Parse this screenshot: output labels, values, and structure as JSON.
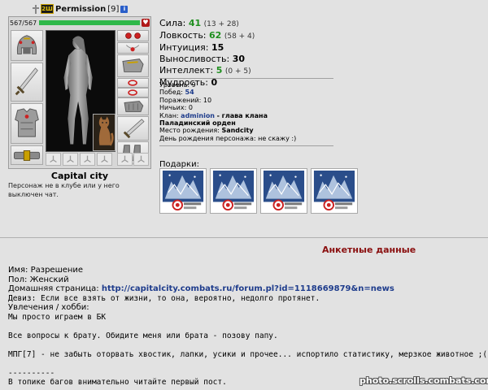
{
  "header": {
    "name": "Permission",
    "level": "[9]",
    "clan_badge": "2Ш",
    "info_icon": "i"
  },
  "hp": {
    "text": "567/567",
    "fraction": 1.0,
    "bar_color": "#2fb84a"
  },
  "stats": [
    {
      "label": "Сила:",
      "value": "41",
      "extra": "(13 + 28)",
      "green": true
    },
    {
      "label": "Ловкость:",
      "value": "62",
      "extra": "(58 + 4)",
      "green": true
    },
    {
      "label": "Интуиция:",
      "value": "15",
      "extra": "",
      "green": false
    },
    {
      "label": "Выносливость:",
      "value": "30",
      "extra": "",
      "green": false
    },
    {
      "label": "Интеллект:",
      "value": "5",
      "extra": "(0 + 5)",
      "green": true
    },
    {
      "label": "Мудрость:",
      "value": "0",
      "extra": "",
      "green": false
    }
  ],
  "info": {
    "level_label": "Уровень:",
    "level": "9",
    "wins_label": "Побед:",
    "wins": "54",
    "losses_label": "Поражений:",
    "losses": "10",
    "draws_label": "Ничьих:",
    "draws": "0",
    "clan_label": "Клан:",
    "clan_name": "adminion",
    "clan_role": "- глава клана",
    "order": "Паладинский орден",
    "birthplace_label": "Место рождения:",
    "birthplace": "Sandcity",
    "birthday_label": "День рождения персонажа:",
    "birthday": "не скажу :)"
  },
  "city": "Capital city",
  "club_note": "Персонаж не в клубе или у него выключен чат.",
  "gifts_label": "Подарки:",
  "anketa_title": "Анкетные данные",
  "profile": {
    "name_label": "Имя:",
    "name": "Разрешение",
    "sex_label": "Пол:",
    "sex": "Женский",
    "home_label": "Домашняя страница:",
    "home_url": "http://capitalcity.combats.ru/forum.pl?id=1118669879&n=news",
    "motto": "Девиз: Если все взять от жизни, то она, вероятно, недолго протянет.",
    "hobby_label": "Увлечения / хобби:",
    "line1": "Мы просто играем в БК",
    "line2": "Все вопросы к брату. Обидите меня или брата - позову папу.",
    "line3": "МПГ[7] - не забыть оторвать хвостик, лапки, усики и прочее... испортило статистику, мерзкое животное ;(",
    "line4": "----------",
    "line5": "В топике багов внимательно читайте первый пост."
  },
  "watermark": "photo.scrolls.combats.com",
  "icons": {
    "helmet": "helmet-icon",
    "sword": "sword-icon",
    "armor": "armor-icon",
    "belt": "belt-icon",
    "bracer": "bracer-icon",
    "gloves": "gloves-icon",
    "boots": "boots-icon",
    "ring": "ring-icon",
    "pet": "cat-pet-icon",
    "gift": "gift-card-icon",
    "heart": "heart-icon"
  }
}
